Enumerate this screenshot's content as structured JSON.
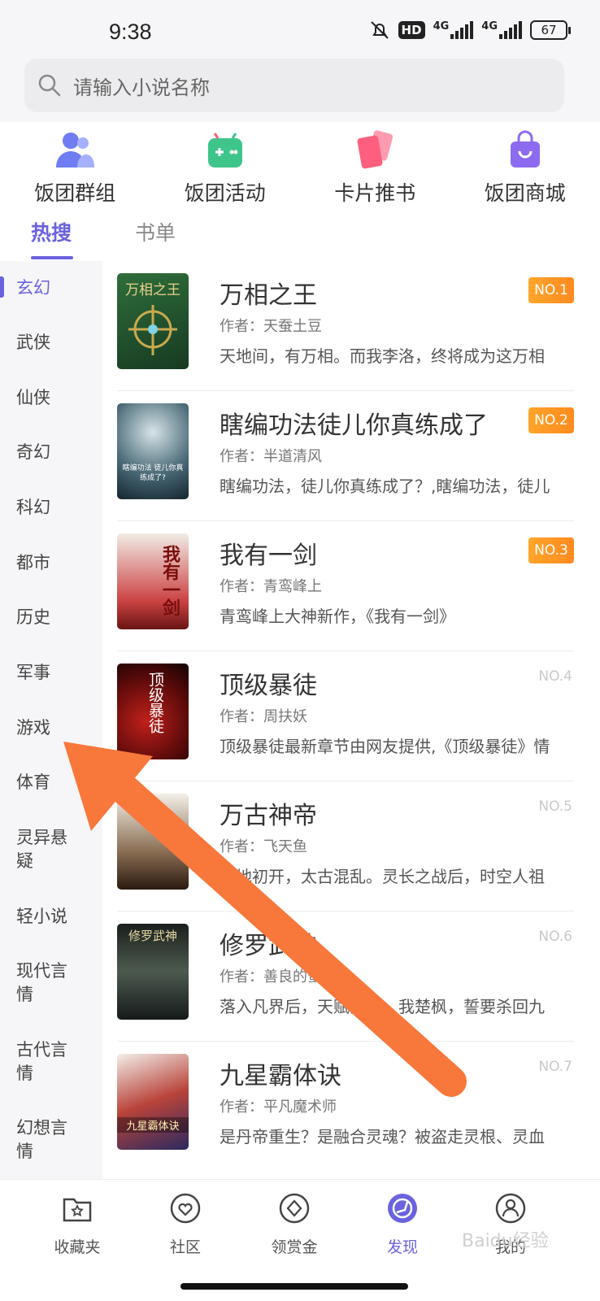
{
  "status_bar": {
    "time": "9:38",
    "hd": "HD",
    "net1": "4G",
    "net2": "4G",
    "battery": "67"
  },
  "search": {
    "placeholder": "请输入小说名称"
  },
  "quick_links": [
    {
      "label": "饭团群组",
      "icon": "group-icon",
      "color": "#6f7cf2"
    },
    {
      "label": "饭团活动",
      "icon": "game-controller-icon",
      "color": "#3ec58a"
    },
    {
      "label": "卡片推书",
      "icon": "cards-icon",
      "color": "#ff5f7e"
    },
    {
      "label": "饭团商城",
      "icon": "shopping-bag-icon",
      "color": "#8c6bf0"
    }
  ],
  "tabs": [
    {
      "label": "热搜"
    },
    {
      "label": "书单"
    }
  ],
  "categories": [
    "玄幻",
    "武侠",
    "仙侠",
    "奇幻",
    "科幻",
    "都市",
    "历史",
    "军事",
    "游戏",
    "体育",
    "灵异悬疑",
    "轻小说",
    "现代言情",
    "古代言情",
    "幻想言情"
  ],
  "active_category": "玄幻",
  "books": [
    {
      "title": "万相之王",
      "author": "作者：天蚕土豆",
      "desc": "天地间，有万相。而我李洛，终将成为这万相",
      "rank": "NO.1",
      "hot": true,
      "cover_text": "万相之王"
    },
    {
      "title": "瞎编功法徒儿你真练成了",
      "author": "作者：半道清风",
      "desc": "瞎编功法，徒儿你真练成了？,瞎编功法，徒儿",
      "rank": "NO.2",
      "hot": true,
      "cover_text": "瞎编功法 徒儿你真练成了?"
    },
    {
      "title": "我有一剑",
      "author": "作者：青鸾峰上",
      "desc": "青鸾峰上大神新作，《我有一剑》",
      "rank": "NO.3",
      "hot": true,
      "cover_text": "我有一剑"
    },
    {
      "title": "顶级暴徒",
      "author": "作者：周扶妖",
      "desc": "顶级暴徒最新章节由网友提供,《顶级暴徒》情",
      "rank": "NO.4",
      "hot": false,
      "cover_text": "顶级暴徒"
    },
    {
      "title": "万古神帝",
      "author": "作者：飞天鱼",
      "desc": "天地初开，太古混乱。灵长之战后，时空人祖",
      "rank": "NO.5",
      "hot": false,
      "cover_text": ""
    },
    {
      "title": "修罗武神",
      "author": "作者：善良的蜜蜂",
      "desc": "落入凡界后，天赋觉醒，我楚枫，誓要杀回九",
      "rank": "NO.6",
      "hot": false,
      "cover_text": "修罗武神"
    },
    {
      "title": "九星霸体诀",
      "author": "作者：平凡魔术师",
      "desc": "是丹帝重生？是融合灵魂？被盗走灵根、灵血",
      "rank": "NO.7",
      "hot": false,
      "cover_text": "九星霸体诀"
    }
  ],
  "bottom_nav": [
    {
      "label": "收藏夹",
      "icon": "favorites-folder-icon"
    },
    {
      "label": "社区",
      "icon": "community-heart-icon"
    },
    {
      "label": "领赏金",
      "icon": "reward-diamond-icon"
    },
    {
      "label": "发现",
      "icon": "discover-compass-icon",
      "active": true
    },
    {
      "label": "我的",
      "icon": "profile-icon"
    }
  ],
  "watermark": "Baidu经验",
  "accent_color": "#6b62e0"
}
